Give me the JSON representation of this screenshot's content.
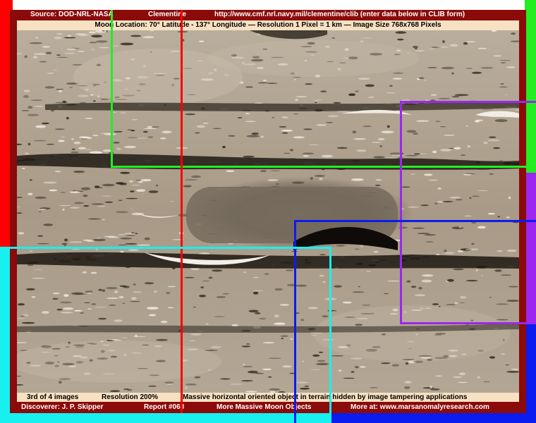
{
  "header": {
    "source": "Source:  DOD-NRL-NASA",
    "mission": "Clementine",
    "url": "http://www.cmf.nrl.navy.mil/clementine/clib  (enter data below in CLIB form)"
  },
  "info_bar": "Moon Location:  70° Latitude - 137° Longitude — Resolution 1 Pixel = 1 km — Image Size 768x768 Pixels",
  "caption": {
    "count": "3rd of 4 images",
    "resolution": "Resolution 200%",
    "description": "Massive horizontal oriented object in terrain hidden by image tampering applications"
  },
  "footer": {
    "discoverer": "Discoverer:  J. P. Skipper",
    "report": "Report #068",
    "related": "More Massive Moon Objects",
    "more": "More at:  www.marsanomalyresearch.com"
  },
  "colors": {
    "frame": "#8b0a0a",
    "label_bar": "#f6e1c2",
    "red": "#ff0000",
    "green": "#22ee22",
    "purple": "#9b27f0",
    "blue": "#0a1cf0",
    "cyan": "#18f0f0"
  }
}
